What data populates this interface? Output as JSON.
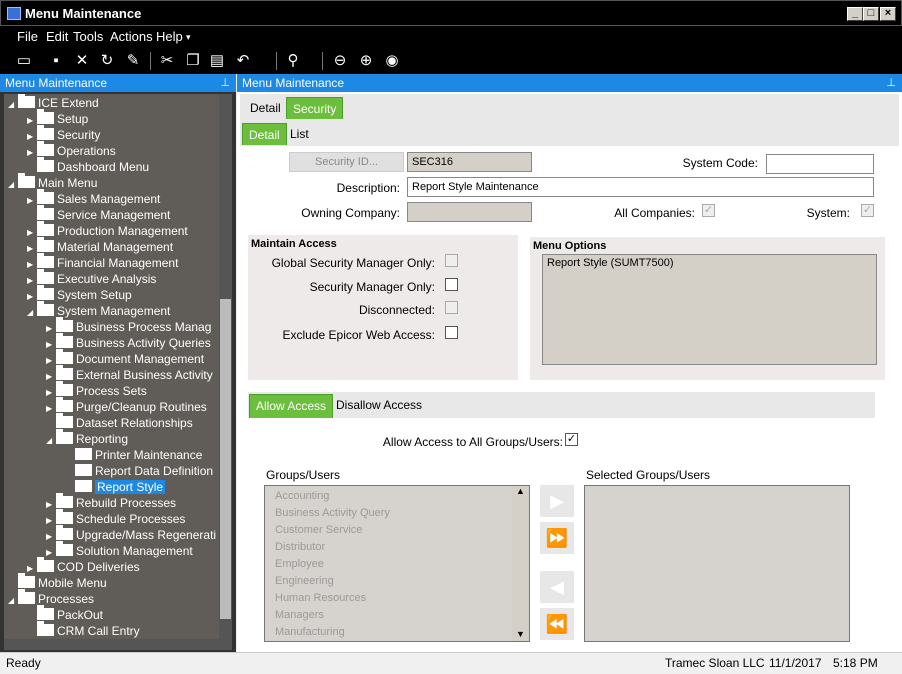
{
  "window": {
    "title": "Menu Maintenance"
  },
  "menubar": [
    "File",
    "Edit",
    "Tools",
    "Actions",
    "Help"
  ],
  "left_panel": {
    "title": "Menu Maintenance"
  },
  "tree": [
    {
      "label": "ICE Extend",
      "level": 0,
      "expanded": true,
      "folder": true
    },
    {
      "label": "Setup",
      "level": 1,
      "expanded": false,
      "folder": true
    },
    {
      "label": "Security",
      "level": 1,
      "expanded": false,
      "folder": true
    },
    {
      "label": "Operations",
      "level": 1,
      "expanded": false,
      "folder": true
    },
    {
      "label": "Dashboard Menu",
      "level": 1,
      "expanded": null,
      "folder": true
    },
    {
      "label": "Main Menu",
      "level": 0,
      "expanded": true,
      "folder": true
    },
    {
      "label": "Sales Management",
      "level": 1,
      "expanded": false,
      "folder": true
    },
    {
      "label": "Service Management",
      "level": 1,
      "expanded": null,
      "folder": true
    },
    {
      "label": "Production Management",
      "level": 1,
      "expanded": false,
      "folder": true
    },
    {
      "label": "Material Management",
      "level": 1,
      "expanded": false,
      "folder": true
    },
    {
      "label": "Financial Management",
      "level": 1,
      "expanded": false,
      "folder": true
    },
    {
      "label": "Executive Analysis",
      "level": 1,
      "expanded": false,
      "folder": true
    },
    {
      "label": "System Setup",
      "level": 1,
      "expanded": false,
      "folder": true
    },
    {
      "label": "System Management",
      "level": 1,
      "expanded": true,
      "folder": true
    },
    {
      "label": "Business Process Manag",
      "level": 2,
      "expanded": false,
      "folder": true
    },
    {
      "label": "Business Activity Queries",
      "level": 2,
      "expanded": false,
      "folder": true
    },
    {
      "label": "Document Management",
      "level": 2,
      "expanded": false,
      "folder": true
    },
    {
      "label": "External Business Activity",
      "level": 2,
      "expanded": false,
      "folder": true
    },
    {
      "label": "Process Sets",
      "level": 2,
      "expanded": false,
      "folder": true
    },
    {
      "label": "Purge/Cleanup Routines",
      "level": 2,
      "expanded": false,
      "folder": true
    },
    {
      "label": "Dataset Relationships",
      "level": 2,
      "expanded": null,
      "folder": true
    },
    {
      "label": "Reporting",
      "level": 2,
      "expanded": true,
      "folder": true
    },
    {
      "label": "Printer Maintenance",
      "level": 3,
      "expanded": null,
      "folder": false
    },
    {
      "label": "Report Data Definition",
      "level": 3,
      "expanded": null,
      "folder": false
    },
    {
      "label": "Report Style",
      "level": 3,
      "expanded": null,
      "folder": false,
      "selected": true
    },
    {
      "label": "Rebuild Processes",
      "level": 2,
      "expanded": false,
      "folder": true
    },
    {
      "label": "Schedule Processes",
      "level": 2,
      "expanded": false,
      "folder": true
    },
    {
      "label": "Upgrade/Mass Regenerati",
      "level": 2,
      "expanded": false,
      "folder": true
    },
    {
      "label": "Solution Management",
      "level": 2,
      "expanded": false,
      "folder": true
    },
    {
      "label": "COD Deliveries",
      "level": 1,
      "expanded": false,
      "folder": true
    },
    {
      "label": "Mobile Menu",
      "level": 0,
      "expanded": null,
      "folder": true
    },
    {
      "label": "Processes",
      "level": 0,
      "expanded": true,
      "folder": true
    },
    {
      "label": "PackOut",
      "level": 1,
      "expanded": null,
      "folder": true
    },
    {
      "label": "CRM Call Entry",
      "level": 1,
      "expanded": null,
      "folder": true
    }
  ],
  "right_panel": {
    "title": "Menu Maintenance",
    "top_tabs": [
      "Detail",
      "Security"
    ],
    "sub_tabs": [
      "Detail",
      "List"
    ],
    "security_id_button": "Security ID...",
    "security_id_value": "SEC316",
    "system_code_label": "System Code:",
    "system_code_value": "",
    "description_label": "Description:",
    "description_value": "Report Style Maintenance",
    "owning_company_label": "Owning Company:",
    "owning_company_value": "",
    "all_companies_label": "All Companies:",
    "system_label": "System:",
    "maintain_access": {
      "title": "Maintain Access",
      "global_security_manager_label": "Global Security Manager Only:",
      "security_manager_label": "Security Manager Only:",
      "disconnected_label": "Disconnected:",
      "exclude_web_label": "Exclude Epicor Web Access:"
    },
    "menu_options": {
      "title": "Menu Options",
      "items": [
        "Report Style (SUMT7500)"
      ]
    },
    "access_tabs": [
      "Allow Access",
      "Disallow Access"
    ],
    "allow_all_label": "Allow Access to All Groups/Users:",
    "groups_users_label": "Groups/Users",
    "selected_groups_label": "Selected Groups/Users",
    "groups": [
      "Accounting",
      "Business Activity Query",
      "Customer Service",
      "Distributor",
      "Employee",
      "Engineering",
      "Human Resources",
      "Managers",
      "Manufacturing"
    ]
  },
  "status": {
    "left": "Ready",
    "company": "Tramec Sloan LLC",
    "date": "11/1/2017",
    "time": "5:18 PM"
  },
  "colors": {
    "accent_blue": "#1e88e5",
    "tab_green": "#6cbf3c",
    "tree_bg": "#605c57"
  }
}
